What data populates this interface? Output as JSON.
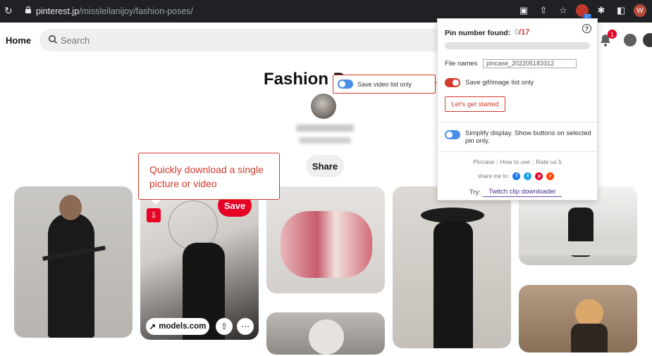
{
  "browser": {
    "url_host": "pinterest.jp",
    "url_path": "/missleilanijoy/fashion-poses/",
    "extension_badge": "17",
    "profile_initial": "W"
  },
  "header": {
    "home_label": "Home",
    "search_placeholder": "Search",
    "notification_count": "1"
  },
  "board": {
    "title": "Fashion P",
    "share_label": "Share"
  },
  "pins": {
    "save_label": "Save",
    "site_chip": "models.com",
    "site_chip_arrow": "↗"
  },
  "callouts": {
    "download_tip": "Quickly download a single picture or video",
    "video_list_label": "Save video list only"
  },
  "extension": {
    "pin_number_label": "Pin number found:",
    "found_count": "0",
    "total_count": "/17",
    "progress": 0,
    "file_names_label": "File names",
    "file_name_value": "pincase_202205183312",
    "gif_label": "Save gif/image list only",
    "start_button": "Let's get started",
    "simplify_label": "Simplify display. Show buttons on selected pin only.",
    "links": [
      "Pincase",
      "How to use",
      "Rate us 5"
    ],
    "share_label": "share me to:",
    "try_label": "Try:",
    "twitch_link": "Twitch clip downloader",
    "accent_color": "#d23a2b",
    "toggle_off_color": "#4a8fe7"
  },
  "colors": {
    "pinterest_red": "#e60023",
    "browser_bar": "#202124"
  }
}
